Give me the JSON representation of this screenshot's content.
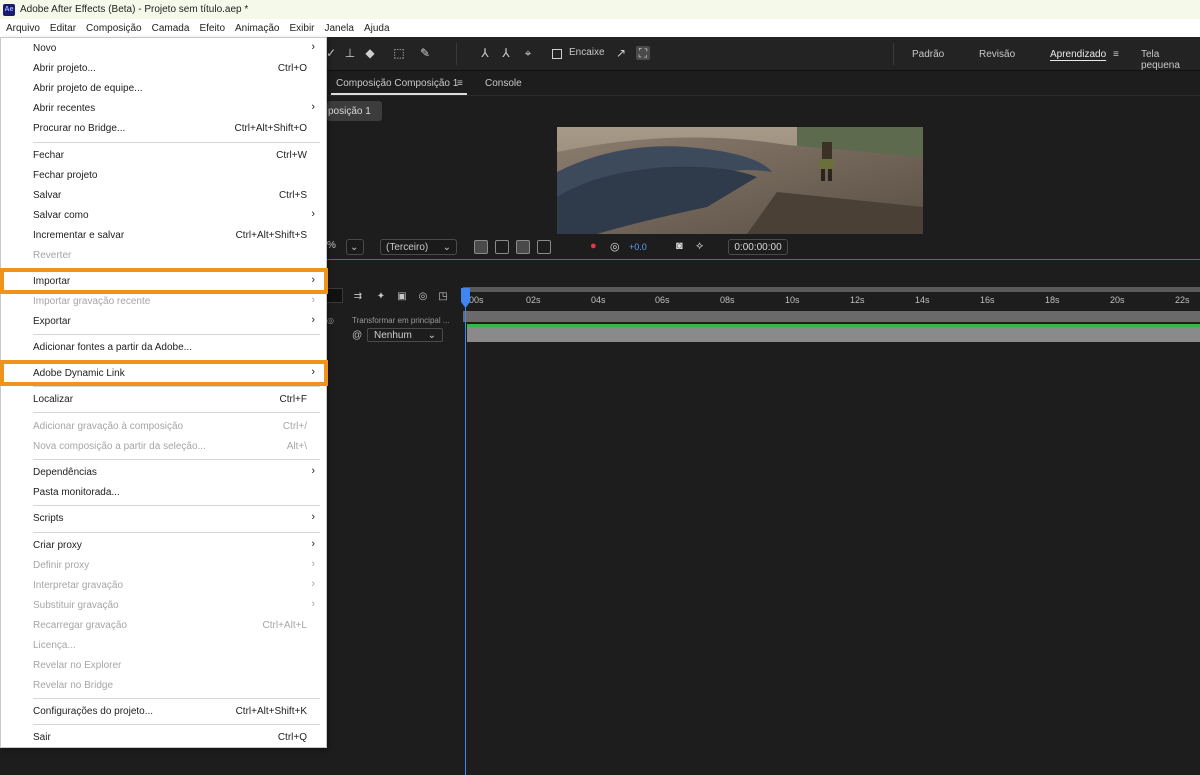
{
  "titlebar": {
    "icon": "Ae",
    "title": "Adobe After Effects (Beta) - Projeto sem título.aep *"
  },
  "menubar": [
    "Arquivo",
    "Editar",
    "Composição",
    "Camada",
    "Efeito",
    "Animação",
    "Exibir",
    "Janela",
    "Ajuda"
  ],
  "toolbar": {
    "snapping_label": "Encaixe",
    "workspaces": [
      "Padrão",
      "Revisão",
      "Aprendizado",
      "Tela pequena"
    ],
    "active_workspace": "Aprendizado",
    "workspace_menu_icon": "≡"
  },
  "panel": {
    "comp_tab": "Composição Composição 1",
    "comp_tab_menu": "≡",
    "console_tab": "Console",
    "subtab": "posição 1"
  },
  "viewer_bar": {
    "zoom_partial": "%",
    "view_dropdown": "(Terceiro)",
    "exposure": "+0.0",
    "timecode": "0:00:00:00"
  },
  "timeline": {
    "ticks": [
      "00s",
      "02s",
      "04s",
      "06s",
      "08s",
      "10s",
      "12s",
      "14s",
      "16s",
      "18s",
      "20s",
      "22s"
    ],
    "column_header": "Transformar em principal ...",
    "parent_value": "Nenhum"
  },
  "menu": {
    "items": [
      {
        "label": "Novo",
        "shortcut": "",
        "submenu": true,
        "disabled": false
      },
      {
        "label": "Abrir projeto...",
        "shortcut": "Ctrl+O",
        "submenu": false,
        "disabled": false
      },
      {
        "label": "Abrir projeto de equipe...",
        "shortcut": "",
        "submenu": false,
        "disabled": false
      },
      {
        "label": "Abrir recentes",
        "shortcut": "",
        "submenu": true,
        "disabled": false
      },
      {
        "label": "Procurar no Bridge...",
        "shortcut": "Ctrl+Alt+Shift+O",
        "submenu": false,
        "disabled": false
      },
      {
        "label": "Fechar",
        "shortcut": "Ctrl+W",
        "submenu": false,
        "disabled": false
      },
      {
        "label": "Fechar projeto",
        "shortcut": "",
        "submenu": false,
        "disabled": false
      },
      {
        "label": "Salvar",
        "shortcut": "Ctrl+S",
        "submenu": false,
        "disabled": false
      },
      {
        "label": "Salvar como",
        "shortcut": "",
        "submenu": true,
        "disabled": false
      },
      {
        "label": "Incrementar e salvar",
        "shortcut": "Ctrl+Alt+Shift+S",
        "submenu": false,
        "disabled": false
      },
      {
        "label": "Reverter",
        "shortcut": "",
        "submenu": false,
        "disabled": true
      },
      {
        "label": "Importar",
        "shortcut": "",
        "submenu": true,
        "disabled": false
      },
      {
        "label": "Importar gravação recente",
        "shortcut": "",
        "submenu": true,
        "disabled": true
      },
      {
        "label": "Exportar",
        "shortcut": "",
        "submenu": true,
        "disabled": false
      },
      {
        "label": "Adicionar fontes a partir da Adobe...",
        "shortcut": "",
        "submenu": false,
        "disabled": false
      },
      {
        "label": "Adobe Dynamic Link",
        "shortcut": "",
        "submenu": true,
        "disabled": false
      },
      {
        "label": "Localizar",
        "shortcut": "Ctrl+F",
        "submenu": false,
        "disabled": false
      },
      {
        "label": "Adicionar gravação à composição",
        "shortcut": "Ctrl+/",
        "submenu": false,
        "disabled": true
      },
      {
        "label": "Nova composição a partir da seleção...",
        "shortcut": "Alt+\\",
        "submenu": false,
        "disabled": true
      },
      {
        "label": "Dependências",
        "shortcut": "",
        "submenu": true,
        "disabled": false
      },
      {
        "label": "Pasta monitorada...",
        "shortcut": "",
        "submenu": false,
        "disabled": false
      },
      {
        "label": "Scripts",
        "shortcut": "",
        "submenu": true,
        "disabled": false
      },
      {
        "label": "Criar proxy",
        "shortcut": "",
        "submenu": true,
        "disabled": false
      },
      {
        "label": "Definir proxy",
        "shortcut": "",
        "submenu": true,
        "disabled": true
      },
      {
        "label": "Interpretar gravação",
        "shortcut": "",
        "submenu": true,
        "disabled": true
      },
      {
        "label": "Substituir gravação",
        "shortcut": "",
        "submenu": true,
        "disabled": true
      },
      {
        "label": "Recarregar gravação",
        "shortcut": "Ctrl+Alt+L",
        "submenu": false,
        "disabled": true
      },
      {
        "label": "Licença...",
        "shortcut": "",
        "submenu": false,
        "disabled": true
      },
      {
        "label": "Revelar no Explorer",
        "shortcut": "",
        "submenu": false,
        "disabled": true
      },
      {
        "label": "Revelar no Bridge",
        "shortcut": "",
        "submenu": false,
        "disabled": true
      },
      {
        "label": "Configurações do projeto...",
        "shortcut": "Ctrl+Alt+Shift+K",
        "submenu": false,
        "disabled": false
      },
      {
        "label": "Sair",
        "shortcut": "Ctrl+Q",
        "submenu": false,
        "disabled": false
      }
    ],
    "highlighted": [
      "Importar",
      "Adobe Dynamic Link"
    ],
    "highlight_color": "#f0931c"
  }
}
